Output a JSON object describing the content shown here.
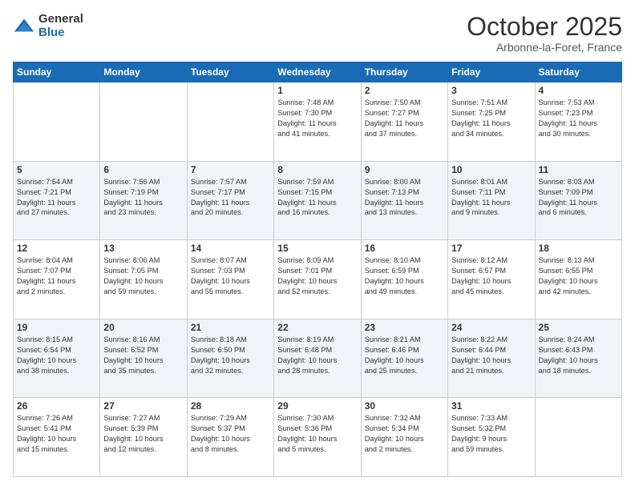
{
  "header": {
    "logo_general": "General",
    "logo_blue": "Blue",
    "month": "October 2025",
    "location": "Arbonne-la-Foret, France"
  },
  "days_of_week": [
    "Sunday",
    "Monday",
    "Tuesday",
    "Wednesday",
    "Thursday",
    "Friday",
    "Saturday"
  ],
  "weeks": [
    [
      {
        "day": "",
        "info": ""
      },
      {
        "day": "",
        "info": ""
      },
      {
        "day": "",
        "info": ""
      },
      {
        "day": "1",
        "info": "Sunrise: 7:48 AM\nSunset: 7:30 PM\nDaylight: 11 hours\nand 41 minutes."
      },
      {
        "day": "2",
        "info": "Sunrise: 7:50 AM\nSunset: 7:27 PM\nDaylight: 11 hours\nand 37 minutes."
      },
      {
        "day": "3",
        "info": "Sunrise: 7:51 AM\nSunset: 7:25 PM\nDaylight: 11 hours\nand 34 minutes."
      },
      {
        "day": "4",
        "info": "Sunrise: 7:53 AM\nSunset: 7:23 PM\nDaylight: 11 hours\nand 30 minutes."
      }
    ],
    [
      {
        "day": "5",
        "info": "Sunrise: 7:54 AM\nSunset: 7:21 PM\nDaylight: 11 hours\nand 27 minutes."
      },
      {
        "day": "6",
        "info": "Sunrise: 7:56 AM\nSunset: 7:19 PM\nDaylight: 11 hours\nand 23 minutes."
      },
      {
        "day": "7",
        "info": "Sunrise: 7:57 AM\nSunset: 7:17 PM\nDaylight: 11 hours\nand 20 minutes."
      },
      {
        "day": "8",
        "info": "Sunrise: 7:59 AM\nSunset: 7:15 PM\nDaylight: 11 hours\nand 16 minutes."
      },
      {
        "day": "9",
        "info": "Sunrise: 8:00 AM\nSunset: 7:13 PM\nDaylight: 11 hours\nand 13 minutes."
      },
      {
        "day": "10",
        "info": "Sunrise: 8:01 AM\nSunset: 7:11 PM\nDaylight: 11 hours\nand 9 minutes."
      },
      {
        "day": "11",
        "info": "Sunrise: 8:03 AM\nSunset: 7:09 PM\nDaylight: 11 hours\nand 6 minutes."
      }
    ],
    [
      {
        "day": "12",
        "info": "Sunrise: 8:04 AM\nSunset: 7:07 PM\nDaylight: 11 hours\nand 2 minutes."
      },
      {
        "day": "13",
        "info": "Sunrise: 8:06 AM\nSunset: 7:05 PM\nDaylight: 10 hours\nand 59 minutes."
      },
      {
        "day": "14",
        "info": "Sunrise: 8:07 AM\nSunset: 7:03 PM\nDaylight: 10 hours\nand 55 minutes."
      },
      {
        "day": "15",
        "info": "Sunrise: 8:09 AM\nSunset: 7:01 PM\nDaylight: 10 hours\nand 52 minutes."
      },
      {
        "day": "16",
        "info": "Sunrise: 8:10 AM\nSunset: 6:59 PM\nDaylight: 10 hours\nand 49 minutes."
      },
      {
        "day": "17",
        "info": "Sunrise: 8:12 AM\nSunset: 6:57 PM\nDaylight: 10 hours\nand 45 minutes."
      },
      {
        "day": "18",
        "info": "Sunrise: 8:13 AM\nSunset: 6:55 PM\nDaylight: 10 hours\nand 42 minutes."
      }
    ],
    [
      {
        "day": "19",
        "info": "Sunrise: 8:15 AM\nSunset: 6:54 PM\nDaylight: 10 hours\nand 38 minutes."
      },
      {
        "day": "20",
        "info": "Sunrise: 8:16 AM\nSunset: 6:52 PM\nDaylight: 10 hours\nand 35 minutes."
      },
      {
        "day": "21",
        "info": "Sunrise: 8:18 AM\nSunset: 6:50 PM\nDaylight: 10 hours\nand 32 minutes."
      },
      {
        "day": "22",
        "info": "Sunrise: 8:19 AM\nSunset: 6:48 PM\nDaylight: 10 hours\nand 28 minutes."
      },
      {
        "day": "23",
        "info": "Sunrise: 8:21 AM\nSunset: 6:46 PM\nDaylight: 10 hours\nand 25 minutes."
      },
      {
        "day": "24",
        "info": "Sunrise: 8:22 AM\nSunset: 6:44 PM\nDaylight: 10 hours\nand 21 minutes."
      },
      {
        "day": "25",
        "info": "Sunrise: 8:24 AM\nSunset: 6:43 PM\nDaylight: 10 hours\nand 18 minutes."
      }
    ],
    [
      {
        "day": "26",
        "info": "Sunrise: 7:26 AM\nSunset: 5:41 PM\nDaylight: 10 hours\nand 15 minutes."
      },
      {
        "day": "27",
        "info": "Sunrise: 7:27 AM\nSunset: 5:39 PM\nDaylight: 10 hours\nand 12 minutes."
      },
      {
        "day": "28",
        "info": "Sunrise: 7:29 AM\nSunset: 5:37 PM\nDaylight: 10 hours\nand 8 minutes."
      },
      {
        "day": "29",
        "info": "Sunrise: 7:30 AM\nSunset: 5:36 PM\nDaylight: 10 hours\nand 5 minutes."
      },
      {
        "day": "30",
        "info": "Sunrise: 7:32 AM\nSunset: 5:34 PM\nDaylight: 10 hours\nand 2 minutes."
      },
      {
        "day": "31",
        "info": "Sunrise: 7:33 AM\nSunset: 5:32 PM\nDaylight: 9 hours\nand 59 minutes."
      },
      {
        "day": "",
        "info": ""
      }
    ]
  ]
}
